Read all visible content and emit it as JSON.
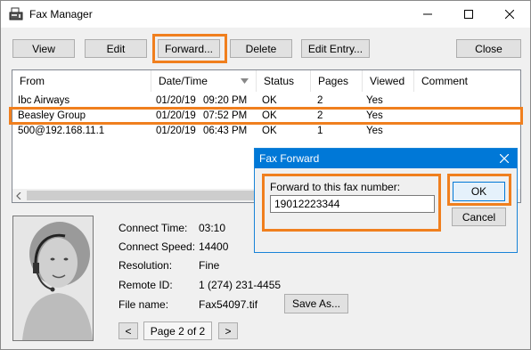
{
  "window": {
    "title": "Fax Manager"
  },
  "toolbar": {
    "view": "View",
    "edit": "Edit",
    "forward": "Forward...",
    "delete": "Delete",
    "edit_entry": "Edit Entry...",
    "close": "Close"
  },
  "list": {
    "columns": [
      "From",
      "Date/Time",
      "Status",
      "Pages",
      "Viewed",
      "Comment"
    ],
    "rows": [
      {
        "from": "Ibc Airways",
        "date": "01/20/19",
        "time": "09:20 PM",
        "status": "OK",
        "pages": "2",
        "viewed": "Yes",
        "comment": ""
      },
      {
        "from": "Beasley Group",
        "date": "01/20/19",
        "time": "07:52 PM",
        "status": "OK",
        "pages": "2",
        "viewed": "Yes",
        "comment": ""
      },
      {
        "from": "500@192.168.11.1",
        "date": "01/20/19",
        "time": "06:43 PM",
        "status": "OK",
        "pages": "1",
        "viewed": "Yes",
        "comment": ""
      }
    ]
  },
  "details": {
    "connect_time_label": "Connect Time:",
    "connect_time": "03:10",
    "connect_speed_label": "Connect Speed:",
    "connect_speed": "14400",
    "resolution_label": "Resolution:",
    "resolution": "Fine",
    "remote_id_label": "Remote ID:",
    "remote_id": "1 (274) 231-4455",
    "file_name_label": "File name:",
    "file_name": "Fax54097.tif",
    "save_as": "Save As...",
    "prev": "<",
    "page": "Page 2 of 2",
    "next": ">"
  },
  "dialog": {
    "title": "Fax Forward",
    "label": "Forward to this fax number:",
    "value": "19012223344",
    "ok": "OK",
    "cancel": "Cancel"
  },
  "colors": {
    "highlight": "#f07f1e",
    "dialog_title": "#0078d7"
  }
}
